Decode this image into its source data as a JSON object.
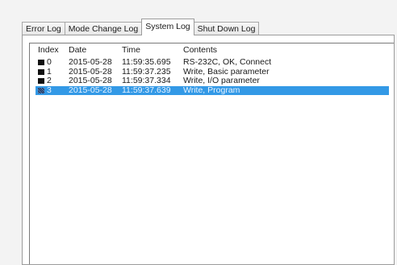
{
  "tabs": [
    {
      "label": "Error Log",
      "active": false
    },
    {
      "label": "Mode Change Log",
      "active": false
    },
    {
      "label": "System Log",
      "active": true
    },
    {
      "label": "Shut Down Log",
      "active": false
    }
  ],
  "columns": {
    "index": "Index",
    "date": "Date",
    "time": "Time",
    "contents": "Contents"
  },
  "rows": [
    {
      "index": "0",
      "date": "2015-05-28",
      "time": "11:59:35.695",
      "contents": "RS-232C, OK, Connect",
      "selected": false
    },
    {
      "index": "1",
      "date": "2015-05-28",
      "time": "11:59:37.235",
      "contents": "Write, Basic parameter",
      "selected": false
    },
    {
      "index": "2",
      "date": "2015-05-28",
      "time": "11:59:37.334",
      "contents": "Write, I/O parameter",
      "selected": false
    },
    {
      "index": "3",
      "date": "2015-05-28",
      "time": "11:59:37.639",
      "contents": "Write, Program",
      "selected": true
    }
  ],
  "colors": {
    "selection": "#3399e6",
    "marker": "#111111"
  },
  "icons": {
    "row_marker": "square-marker-icon"
  }
}
